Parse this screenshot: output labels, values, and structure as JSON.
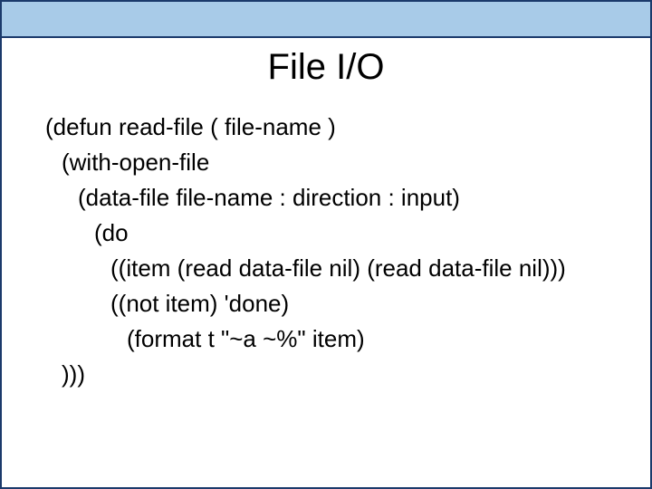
{
  "title": "File I/O",
  "code": {
    "l1": "(defun read-file ( file-name )",
    "l2": "(with-open-file",
    "l3": "(data-file file-name : direction : input)",
    "l4": "(do",
    "l5": "((item (read data-file nil) (read data-file nil)))",
    "l6": "((not item) 'done)",
    "l7": "(format t \"~a ~%\" item)",
    "l8": ")))"
  }
}
